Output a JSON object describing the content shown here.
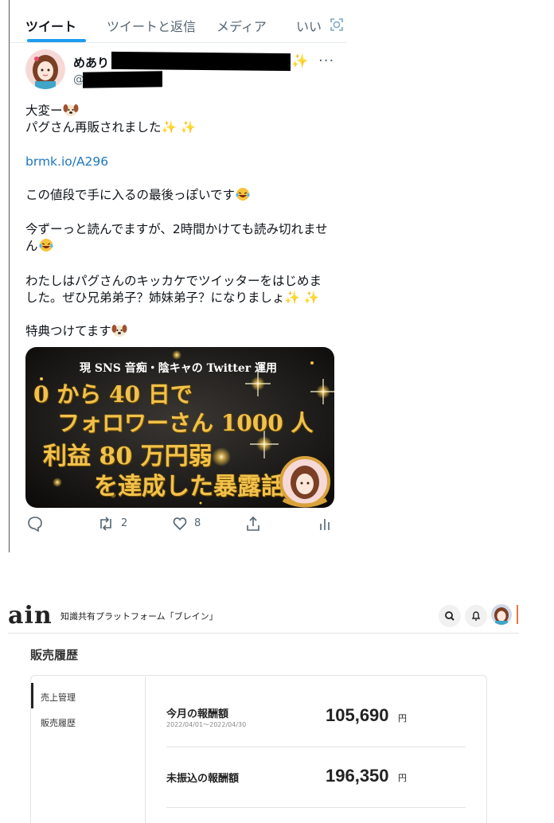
{
  "tweet_tabs": [
    "ツイート",
    "ツイートと返信",
    "メディア",
    "いい"
  ],
  "author": {
    "name": "めあり",
    "handle": "@"
  },
  "tweet_lines": [
    "大変ー",
    "パグさん再販されました",
    "brmk.io/A296",
    "この値段で手に入るの最後っぽいです",
    "今ずーっと読んでますが、2時間かけても読み切れませ",
    "ん",
    "わたしはパグさんのキッカケでツイッターをはじめま",
    "した。ぜひ兄弟弟子？姉妹弟子？になりましょ",
    "特典つけてます"
  ],
  "banner": {
    "subtitle": "現 SNS 音痴・陰キャの Twitter 運用",
    "line1": "0 から 40 日で",
    "line2": "フォロワーさん 1000 人",
    "line3": "利益 80 万円弱",
    "line4": "を達成した暴露話"
  },
  "actions": {
    "retweets": "2",
    "likes": "8"
  },
  "brain": {
    "logo": "ain",
    "tagline": "知識共有プラットフォーム「ブレイン」",
    "page_title": "販売履歴",
    "sidebar": [
      "売上管理",
      "販売履歴"
    ],
    "rows": [
      {
        "label": "今月の報酬額",
        "sub": "2022/04/01～2022/04/30",
        "amount": "105,690",
        "unit": "円"
      },
      {
        "label": "未振込の報酬額",
        "sub": "",
        "amount": "196,350",
        "unit": "円"
      }
    ]
  },
  "colors": {
    "twitter_blue": "#1d9bf0",
    "link": "#1d77c2",
    "gold": "#f2c14b",
    "accent_orange": "#e8763a"
  }
}
